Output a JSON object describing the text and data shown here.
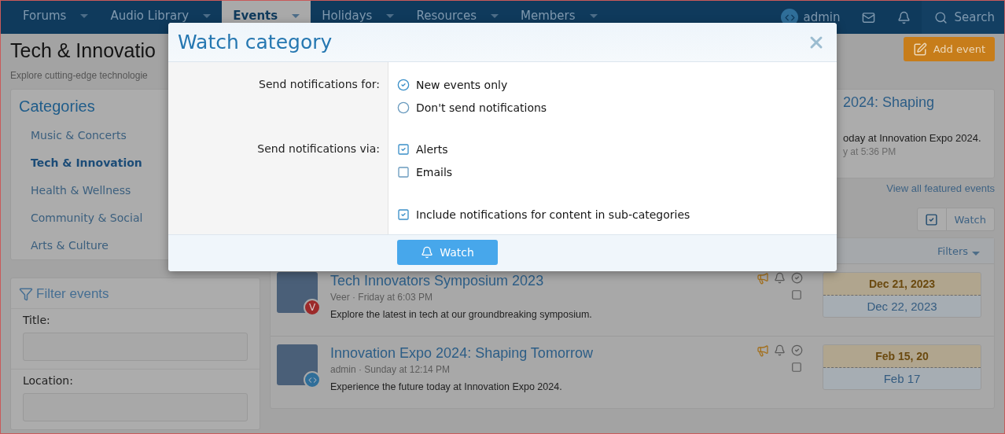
{
  "nav": {
    "items": [
      {
        "label": "Forums",
        "selected": false
      },
      {
        "label": "Audio Library",
        "selected": false
      },
      {
        "label": "Events",
        "selected": true
      },
      {
        "label": "Holidays",
        "selected": false
      },
      {
        "label": "Resources",
        "selected": false
      },
      {
        "label": "Members",
        "selected": false
      }
    ],
    "user": "admin",
    "search": "Search"
  },
  "page": {
    "title": "Tech & Innovatio",
    "subtitle": "Explore cutting-edge technologie",
    "add_event": "Add event"
  },
  "categories": {
    "title": "Categories",
    "items": [
      {
        "label": "Music & Concerts",
        "selected": false
      },
      {
        "label": "Tech & Innovation",
        "selected": true
      },
      {
        "label": "Health & Wellness",
        "selected": false
      },
      {
        "label": "Community & Social",
        "selected": false
      },
      {
        "label": "Arts & Culture",
        "selected": false
      }
    ]
  },
  "filter": {
    "title": "Filter events",
    "fields": [
      {
        "label": "Title:"
      },
      {
        "label": "Location:"
      }
    ]
  },
  "featured": {
    "title": "2024: Shaping",
    "description": "oday at Innovation Expo 2024.",
    "meta": "y at 5:36 PM",
    "view_all": "View all featured events"
  },
  "actions": {
    "watch": "Watch"
  },
  "events": {
    "filters": "Filters",
    "rows": [
      {
        "title": "Tech Innovators Symposium 2023",
        "meta": "Veer · Friday at 6:03 PM",
        "selected": false,
        "description": "Explore the latest in tech at our groundbreaking symposium.",
        "start": "Dec 21, 2023",
        "end": "Dec 22, 2023",
        "badge": {
          "kind": "letter",
          "text": "V"
        }
      },
      {
        "title": "Innovation Expo 2024: Shaping Tomorrow",
        "meta": "admin · Sunday at 12:14 PM",
        "selected": false,
        "description": "Experience the future today at Innovation Expo 2024.",
        "start": "Feb 15, 20",
        "end": "Feb 17",
        "badge": {
          "kind": "logo"
        }
      }
    ]
  },
  "modal": {
    "title": "Watch category",
    "sections": [
      {
        "label": "Send notifications for:",
        "kind": "radio",
        "options": [
          {
            "label": "New events only",
            "selected": true
          },
          {
            "label": "Don't send notifications",
            "selected": false
          }
        ]
      },
      {
        "label": "Send notifications via:",
        "kind": "checkbox",
        "options": [
          {
            "label": "Alerts",
            "checked": true
          },
          {
            "label": "Emails",
            "checked": false
          }
        ]
      },
      {
        "kind": "checkbox",
        "options": [
          {
            "label": "Include notifications for content in sub-categories",
            "checked": true
          }
        ]
      }
    ],
    "button": "Watch"
  }
}
